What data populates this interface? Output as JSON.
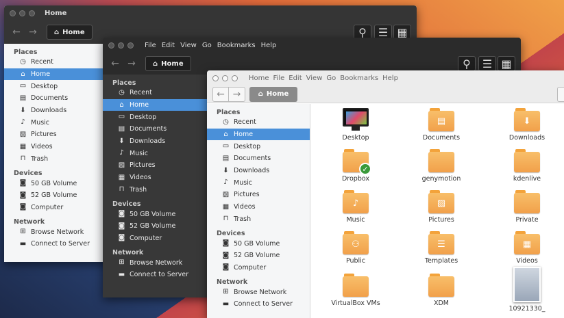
{
  "windows": [
    {
      "key": "w1",
      "title": "Home",
      "menu": [],
      "location": "Home",
      "sidebar": {
        "places_header": "Places",
        "places": [
          {
            "label": "Recent",
            "icon": "clock-icon"
          },
          {
            "label": "Home",
            "icon": "home-icon",
            "selected": true
          },
          {
            "label": "Desktop",
            "icon": "monitor-icon"
          },
          {
            "label": "Documents",
            "icon": "document-icon"
          },
          {
            "label": "Downloads",
            "icon": "download-icon"
          },
          {
            "label": "Music",
            "icon": "music-icon"
          },
          {
            "label": "Pictures",
            "icon": "picture-icon"
          },
          {
            "label": "Videos",
            "icon": "film-icon"
          },
          {
            "label": "Trash",
            "icon": "trash-icon"
          }
        ],
        "devices_header": "Devices",
        "devices": [
          {
            "label": "50 GB Volume",
            "icon": "drive-icon"
          },
          {
            "label": "52 GB Volume",
            "icon": "drive-icon"
          },
          {
            "label": "Computer",
            "icon": "drive-icon"
          }
        ],
        "network_header": "Network",
        "network": [
          {
            "label": "Browse Network",
            "icon": "network-icon"
          },
          {
            "label": "Connect to Server",
            "icon": "server-icon"
          }
        ]
      }
    },
    {
      "key": "w2",
      "title": "",
      "menu": [
        "File",
        "Edit",
        "View",
        "Go",
        "Bookmarks",
        "Help"
      ],
      "location": "Home"
    },
    {
      "key": "w3",
      "title": "",
      "menu": [
        "Home",
        "File",
        "Edit",
        "View",
        "Go",
        "Bookmarks",
        "Help"
      ],
      "location": "Home"
    }
  ],
  "files": [
    {
      "label": "Desktop",
      "icon": "desktop-icon"
    },
    {
      "label": "Documents",
      "icon": "document-icon"
    },
    {
      "label": "Downloads",
      "icon": "download-icon"
    },
    {
      "label": "Dropbox",
      "icon": "dropbox-check-icon"
    },
    {
      "label": "genymotion",
      "icon": "folder-icon"
    },
    {
      "label": "kdenlive",
      "icon": "folder-icon"
    },
    {
      "label": "Music",
      "icon": "music-icon"
    },
    {
      "label": "Pictures",
      "icon": "picture-icon"
    },
    {
      "label": "Private",
      "icon": "folder-icon"
    },
    {
      "label": "Public",
      "icon": "people-icon"
    },
    {
      "label": "Templates",
      "icon": "template-icon"
    },
    {
      "label": "Videos",
      "icon": "film-icon"
    },
    {
      "label": "VirtualBox VMs",
      "icon": "folder-icon"
    },
    {
      "label": "XDM",
      "icon": "folder-icon"
    },
    {
      "label": "10921330_",
      "icon": "photo-thumbnail"
    }
  ],
  "colors": {
    "selection": "#4a90d9",
    "folder": "#f4a94a",
    "dark_bg": "#3b3b3b",
    "darker_bg": "#2d2d2d",
    "light_sidebar": "#f5f6f7"
  }
}
